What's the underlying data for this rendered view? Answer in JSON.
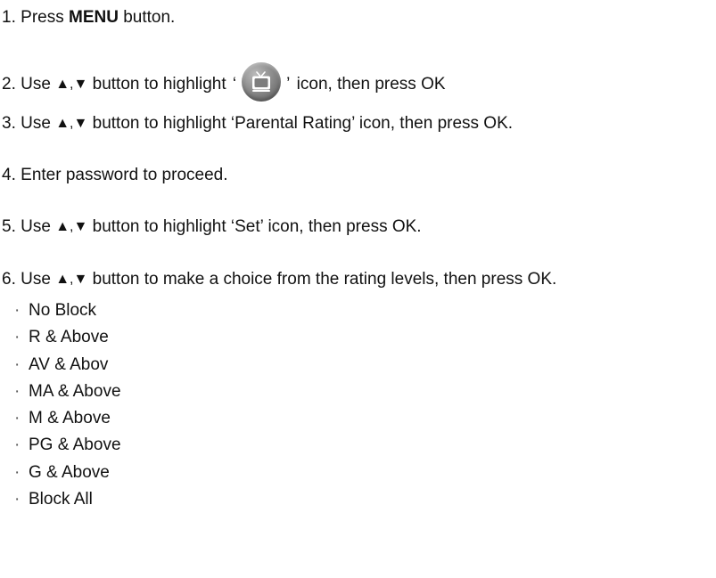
{
  "steps": [
    {
      "number": "1.",
      "before": "Press",
      "emphasis": "MENU",
      "after": "button."
    },
    {
      "number": "2.",
      "before": "Use",
      "arrows": "▲,▼",
      "middle": "button to highlight",
      "open_quote": "‘",
      "icon": "tv-menu-icon",
      "close_quote": "’",
      "after": "icon, then press OK"
    },
    {
      "number": "3.",
      "before": "Use",
      "arrows": "▲,▼",
      "after": "button to highlight ‘Parental Rating’ icon, then press OK."
    },
    {
      "number": "4.",
      "text": "Enter password to proceed."
    },
    {
      "number": "5.",
      "before": "Use",
      "arrows": "▲,▼",
      "after": "button to highlight ‘Set’ icon, then press OK."
    },
    {
      "number": "6.",
      "before": "Use",
      "arrows": "▲,▼",
      "after": "button to make a choice from the rating levels, then press OK."
    }
  ],
  "rating_levels": {
    "bullet": "·",
    "items": [
      "No Block",
      "R & Above",
      "AV & Abov",
      "MA & Above",
      "M & Above",
      "PG & Above",
      "G & Above",
      "Block All"
    ]
  }
}
